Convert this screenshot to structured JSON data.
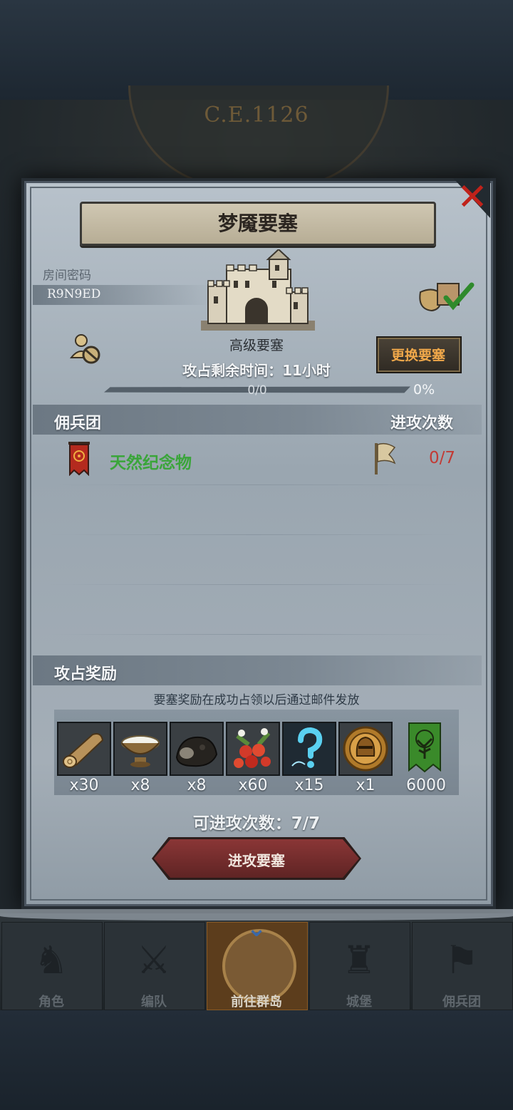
{
  "era": "C.E.1126",
  "modal": {
    "title": "梦魇要塞",
    "room_label": "房间密码",
    "room_code": "R9N9ED",
    "fortress_name": "高级要塞",
    "time_remaining": "攻占剩余时间：11小时",
    "change_button": "更换要塞",
    "progress_text": "0/0",
    "progress_percent": "0%",
    "progress_value": 0
  },
  "mercenary": {
    "header_left": "佣兵团",
    "header_right": "进攻次数",
    "rows": [
      {
        "name": "天然纪念物",
        "attacks": "0/7"
      }
    ]
  },
  "rewards": {
    "header": "攻占奖励",
    "note": "要塞奖励在成功占领以后通过邮件发放",
    "items": [
      {
        "icon": "wood-log-icon",
        "count": "x30"
      },
      {
        "icon": "salt-bowl-icon",
        "count": "x8"
      },
      {
        "icon": "ore-rock-icon",
        "count": "x8"
      },
      {
        "icon": "berries-icon",
        "count": "x60"
      },
      {
        "icon": "mystery-question-icon",
        "count": "x15"
      },
      {
        "icon": "knight-helmet-coin-icon",
        "count": "x1"
      },
      {
        "icon": "guild-tree-banner-icon",
        "count": "6000"
      }
    ]
  },
  "attacks_available": "可进攻次数：7/7",
  "attack_button": "进攻要塞",
  "nav": [
    {
      "label": "角色",
      "icon": "knight-icon"
    },
    {
      "label": "编队",
      "icon": "formation-icon"
    },
    {
      "label": "前往群岛",
      "icon": "compass-icon"
    },
    {
      "label": "城堡",
      "icon": "castle-icon"
    },
    {
      "label": "佣兵团",
      "icon": "mercenary-icon"
    }
  ],
  "colors": {
    "merc_name": "#3aa53a",
    "attack_count": "#c23a34",
    "change_button_text": "#f0a84a",
    "close": "#c0221a"
  }
}
